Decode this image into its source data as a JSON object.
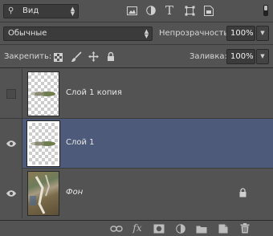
{
  "filter": {
    "kind_label": "Вид"
  },
  "blend": {
    "mode": "Обычные",
    "opacity_label": "Непрозрачность:",
    "opacity_value": "100%"
  },
  "lock": {
    "label": "Закрепить:",
    "fill_label": "Заливка:",
    "fill_value": "100%"
  },
  "layers": [
    {
      "name": "Слой 1 копия",
      "visible": false,
      "selected": false,
      "locked": false
    },
    {
      "name": "Слой 1",
      "visible": true,
      "selected": true,
      "locked": false
    },
    {
      "name": "Фон",
      "visible": true,
      "selected": false,
      "locked": true
    }
  ],
  "colors": {
    "panel_bg": "#535353",
    "selected_row": "#4d5a7a",
    "field_bg": "#3b3b3b"
  },
  "icons": {
    "filters": [
      "image-filter-icon",
      "adjustment-filter-icon",
      "type-filter-icon",
      "shape-filter-icon",
      "smart-object-filter-icon",
      "toggle-filter-icon"
    ],
    "locks": [
      "lock-transparent-pixels-icon",
      "lock-image-pixels-icon",
      "lock-position-icon",
      "lock-all-icon"
    ],
    "footer": [
      "link-layers-icon",
      "fx-icon",
      "add-mask-icon",
      "adjustment-layer-icon",
      "new-group-icon",
      "new-layer-icon",
      "delete-icon"
    ]
  }
}
